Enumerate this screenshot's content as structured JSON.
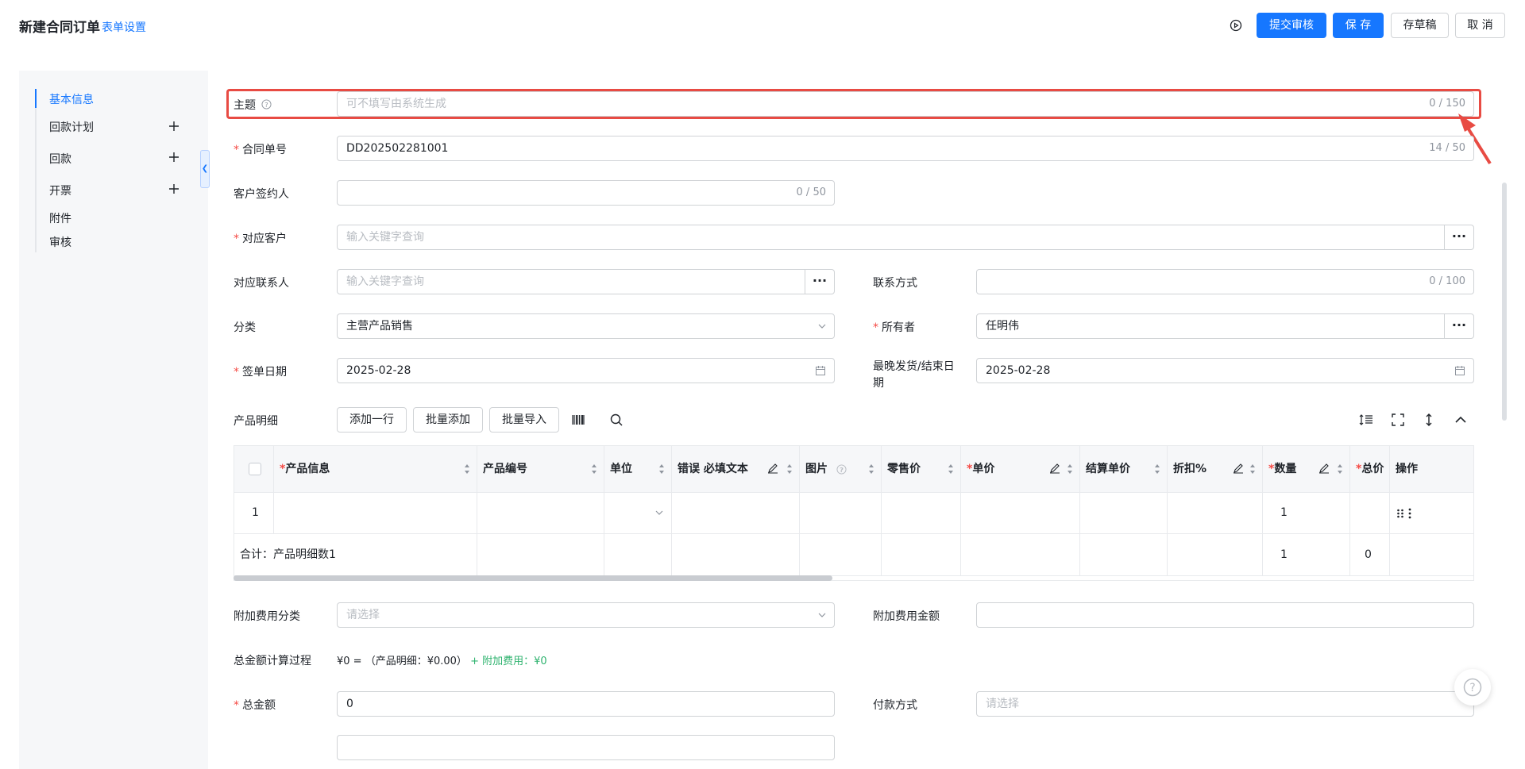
{
  "header": {
    "title": "新建合同订单",
    "form_settings": "表单设置",
    "submit_review": "提交审核",
    "save": "保 存",
    "draft": "存草稿",
    "cancel": "取 消"
  },
  "sidebar": {
    "items": [
      {
        "label": "基本信息"
      },
      {
        "label": "回款计划"
      },
      {
        "label": "回款"
      },
      {
        "label": "开票"
      },
      {
        "label": "附件"
      },
      {
        "label": "审核"
      }
    ]
  },
  "form": {
    "subject": {
      "label": "主题",
      "placeholder": "可不填写由系统生成",
      "counter": "0 / 150"
    },
    "contract_no": {
      "label": "合同单号",
      "value": "DD202502281001",
      "counter": "14 / 50"
    },
    "customer_signer": {
      "label": "客户签约人",
      "counter": "0 / 50"
    },
    "customer": {
      "label": "对应客户",
      "placeholder": "输入关键字查询",
      "more": "···"
    },
    "contact": {
      "label": "对应联系人",
      "placeholder": "输入关键字查询",
      "more": "···"
    },
    "contact_method": {
      "label": "联系方式",
      "counter": "0 / 100"
    },
    "category": {
      "label": "分类",
      "value": "主营产品销售"
    },
    "owner": {
      "label": "所有者",
      "value": "任明伟",
      "more": "···"
    },
    "sign_date": {
      "label": "签单日期",
      "value": "2025-02-28"
    },
    "latest_delivery": {
      "label_line1": "最晚发货/结束日",
      "label_line2": "期",
      "value": "2025-02-28"
    },
    "product_detail": {
      "label": "产品明细",
      "add_row": "添加一行",
      "batch_add": "批量添加",
      "batch_import": "批量导入"
    },
    "extra_fee_category": {
      "label": "附加费用分类",
      "placeholder": "请选择"
    },
    "extra_fee_amount": {
      "label": "附加费用金额"
    },
    "calc_process": {
      "label": "总金额计算过程",
      "text": "¥0 = （产品明细：¥0.00）",
      "extra": "+ 附加费用：¥0"
    },
    "total_amount": {
      "label": "总金额",
      "value": "0"
    },
    "payment_method": {
      "label": "付款方式",
      "placeholder": "请选择"
    }
  },
  "table": {
    "headers": {
      "product_info": "产品信息",
      "product_code": "产品编号",
      "unit": "单位",
      "error_required": "错误 必填文本",
      "image": "图片",
      "retail_price": "零售价",
      "unit_price": "单价",
      "settle_price": "结算单价",
      "discount": "折扣%",
      "quantity": "数量",
      "total_price": "总价",
      "actions": "操作"
    },
    "row1": {
      "index": "1",
      "quantity": "1"
    },
    "summary": {
      "label": "合计：产品明细数1",
      "quantity": "1",
      "total": "0"
    }
  },
  "colors": {
    "primary": "#1677ff",
    "required": "#f54a45",
    "highlight": "#e84b43",
    "green": "#2fb36f"
  },
  "icons": [
    "play-circle-icon",
    "plus-icon",
    "collapse-icon",
    "help-icon",
    "chevron-down-icon",
    "calendar-icon",
    "barcode-icon",
    "search-icon",
    "line-height-icon",
    "fullscreen-icon",
    "expand-vertical-icon",
    "chevron-up-icon",
    "sort-icon",
    "edit-icon",
    "drag-icon",
    "more-vertical-icon",
    "red-arrow-icon"
  ]
}
